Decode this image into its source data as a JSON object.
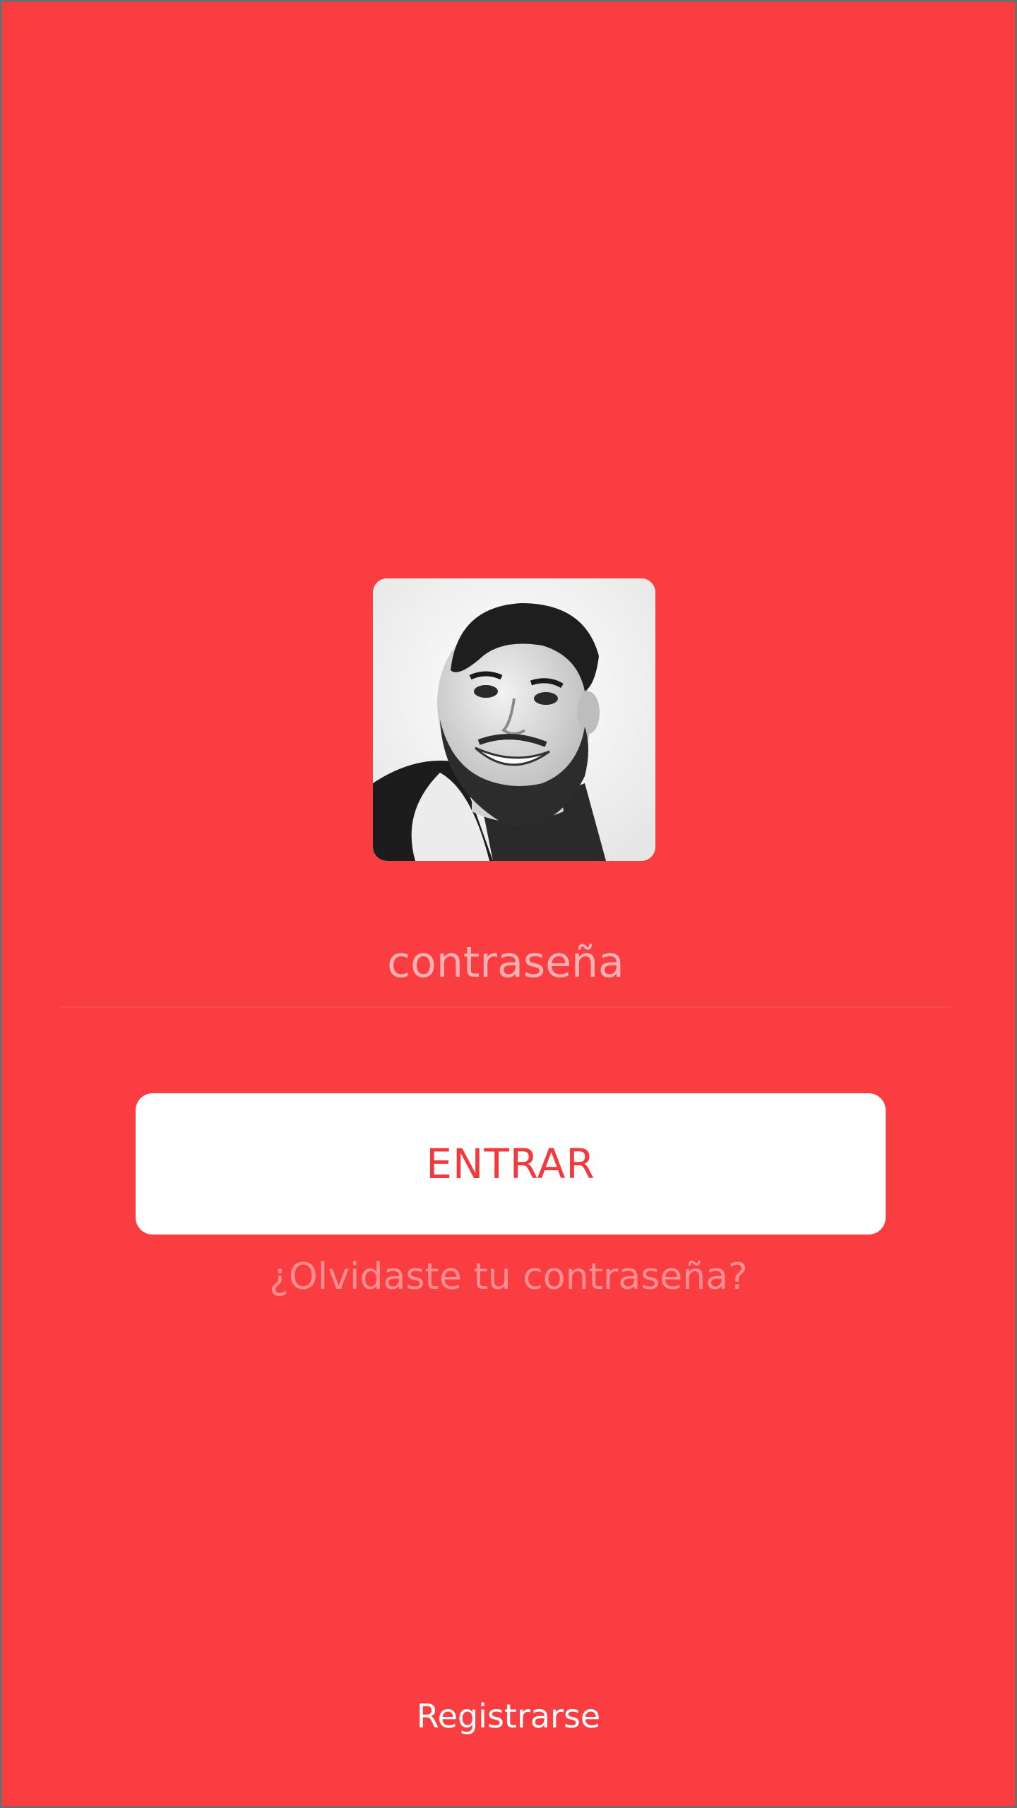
{
  "login": {
    "password_placeholder": "contraseña",
    "submit_label": "ENTRAR",
    "forgot_label": "¿Olvidaste tu contraseña?",
    "register_label": "Registrarse"
  },
  "colors": {
    "background": "#f93d41",
    "button_bg": "#ffffff",
    "button_text": "#f23a3e",
    "placeholder": "#ffb0b2",
    "forgot_link": "#ff8e91",
    "register_link": "#ffffff"
  },
  "icons": {
    "avatar": "user-photo"
  }
}
